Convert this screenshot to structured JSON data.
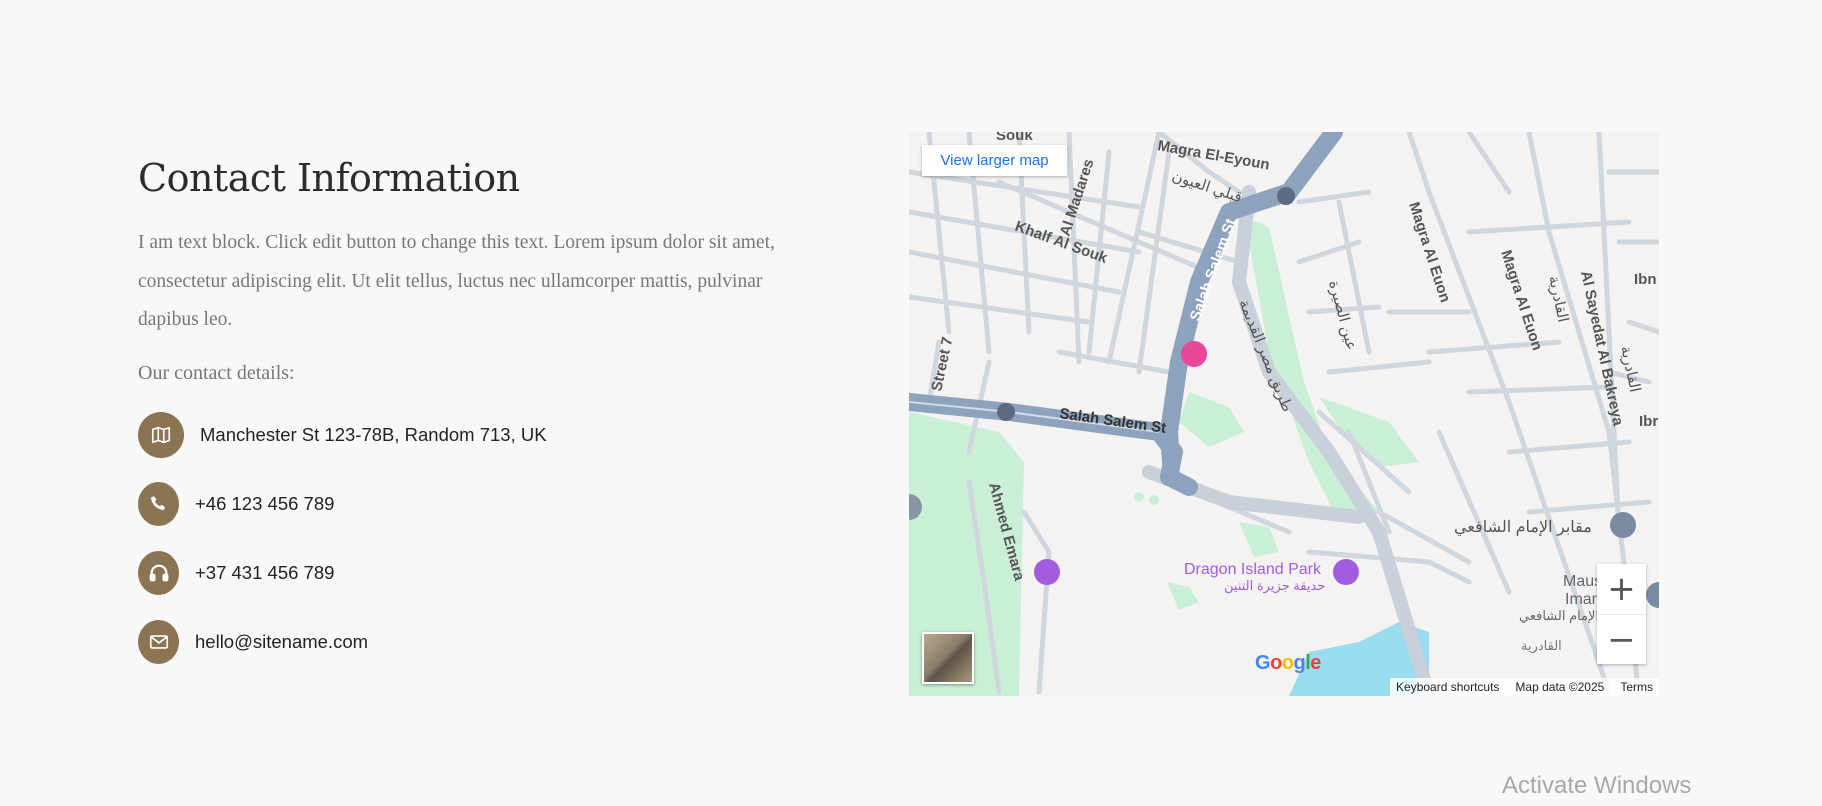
{
  "contact": {
    "title": "Contact Information",
    "intro": "I am text block. Click edit button to change this text. Lorem ipsum dolor sit amet, consectetur adipiscing elit. Ut elit tellus, luctus nec ullamcorper mattis, pulvinar dapibus leo.",
    "details_heading": "Our contact details:",
    "items": [
      {
        "icon": "map-icon",
        "text": "Manchester St 123-78B, Random 713, UK"
      },
      {
        "icon": "phone-icon",
        "text": "+46 123 456 789"
      },
      {
        "icon": "headphones-icon",
        "text": "+37 431 456 789"
      },
      {
        "icon": "envelope-icon",
        "text": "hello@sitename.com"
      }
    ],
    "accent_color": "#8a7451"
  },
  "map": {
    "view_larger": "View larger map",
    "labels": {
      "magra_el_eyoun": "Magra El-Eyoun",
      "magra_el_eyoun_ar": "قبلي العيون",
      "al_madares": "Al Madares",
      "khalf_al_souk": "Khalf Al Souk",
      "souk": "Souk",
      "salah_salem_upper": "Salah Salem St",
      "salah_salem_lower": "Salah Salem St",
      "old_cairo_road_ar": "طريق مصر القديمة",
      "street_7": "Street 7",
      "ahmed_emara": "Ahmed Emara",
      "ain_al_sira_ar": "عين الصيرة",
      "magra_al_euon_1": "Magra Al Euon",
      "magra_al_euon_2": "Magra Al Euon",
      "al_qadiriya_ar": "القادرية",
      "al_sayedat": "Al Sayedat Al Bakreya",
      "al_qadiriya_ar_2": "القادرية",
      "imam_shafei_tombs_ar": "مقابر الإمام الشافعي",
      "dragon_island_park": "Dragon Island Park",
      "dragon_island_park_ar": "حديقة جزيرة التنين",
      "mausoleum": "Mausoleu",
      "imam_al": "Imam al-S",
      "imam_shafei_ar": "الإمام الشافعي",
      "qadiriya_bottom_ar": "القادرية",
      "ibn_1": "Ibn",
      "ibn_2": "Ibr"
    },
    "zoom_in": "+",
    "zoom_out": "−",
    "google": "Google",
    "attribution": {
      "shortcuts": "Keyboard shortcuts",
      "data": "Map data ©2025",
      "terms": "Terms"
    }
  },
  "watermark": "Activate Windows"
}
